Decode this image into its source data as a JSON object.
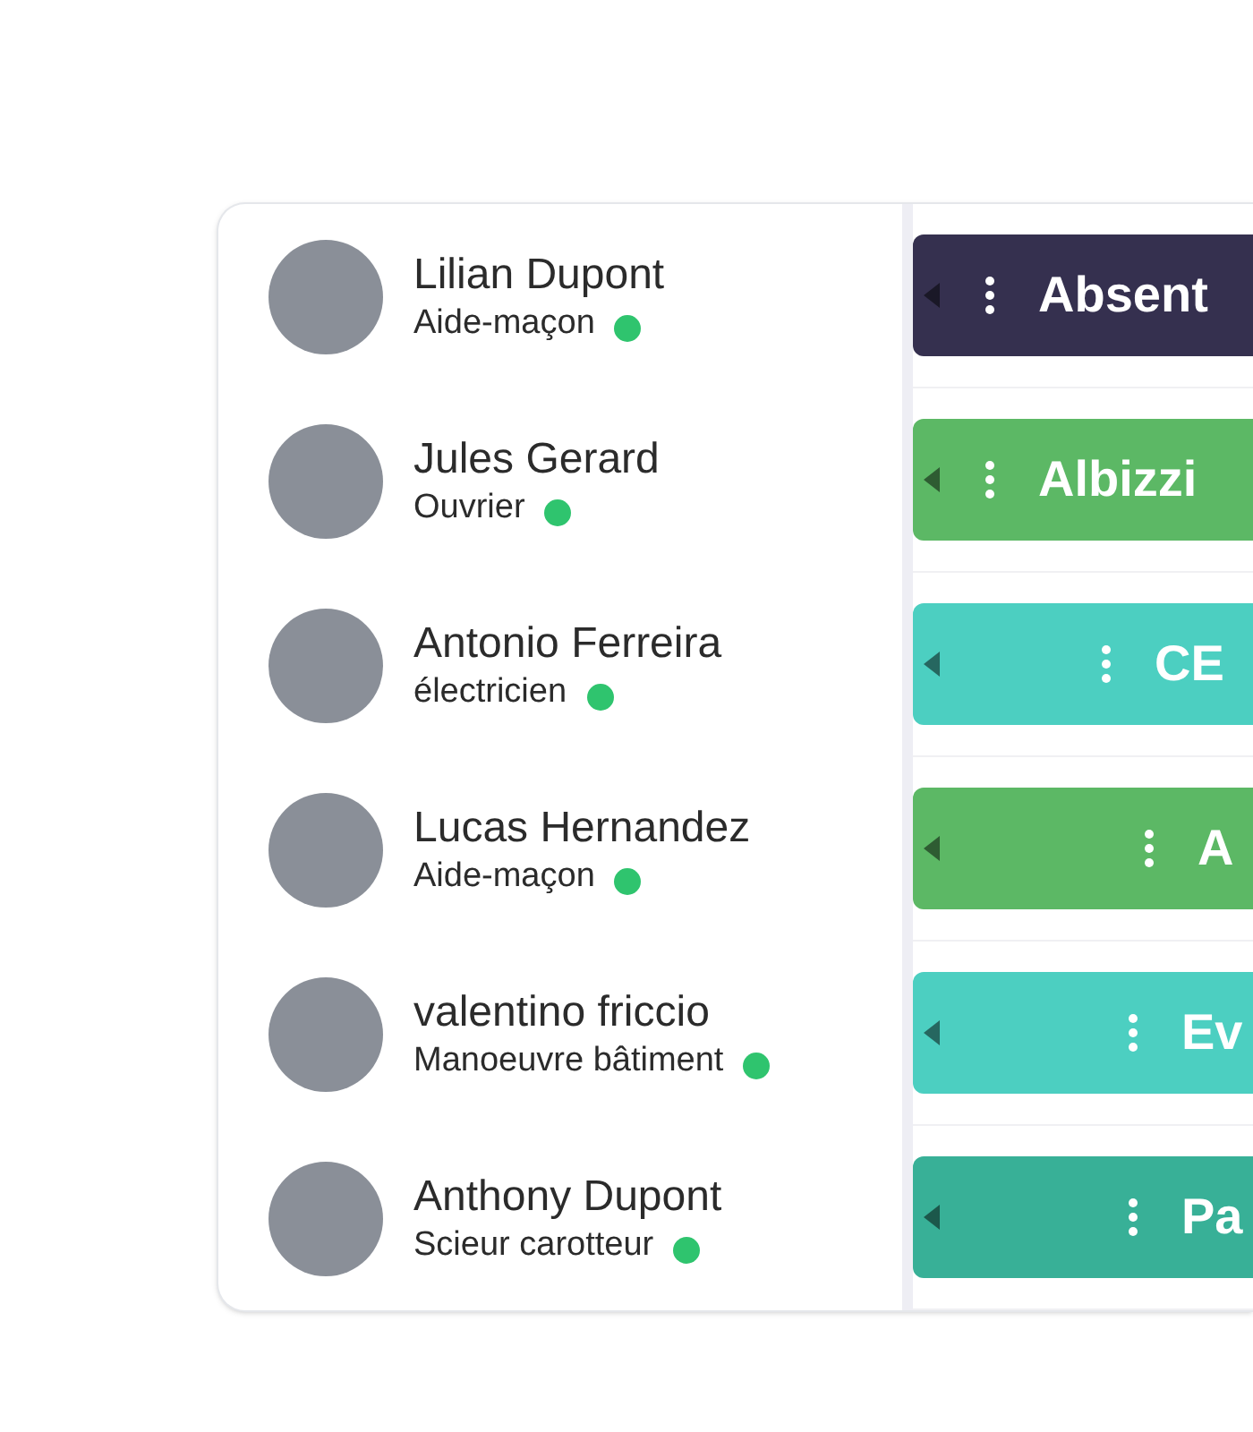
{
  "rows": [
    {
      "name": "Lilian Dupont",
      "role": "Aide-maçon",
      "online": true,
      "bar": {
        "label": "Absent",
        "color": "#35304f"
      }
    },
    {
      "name": "Jules Gerard",
      "role": "Ouvrier",
      "online": true,
      "bar": {
        "label": "Albizzi",
        "color": "#5cb865"
      }
    },
    {
      "name": "Antonio Ferreira",
      "role": "électricien",
      "online": true,
      "bar": {
        "label": "CE",
        "color": "#4ccfc1"
      }
    },
    {
      "name": "Lucas Hernandez",
      "role": "Aide-maçon",
      "online": true,
      "bar": {
        "label": "A",
        "color": "#5cb865"
      }
    },
    {
      "name": "valentino friccio",
      "role": "Manoeuvre bâtiment",
      "online": true,
      "bar": {
        "label": "Ev",
        "color": "#4ccfc1"
      }
    },
    {
      "name": "Anthony Dupont",
      "role": "Scieur carotteur",
      "online": true,
      "bar": {
        "label": "Pa",
        "color": "#38b097"
      }
    }
  ]
}
